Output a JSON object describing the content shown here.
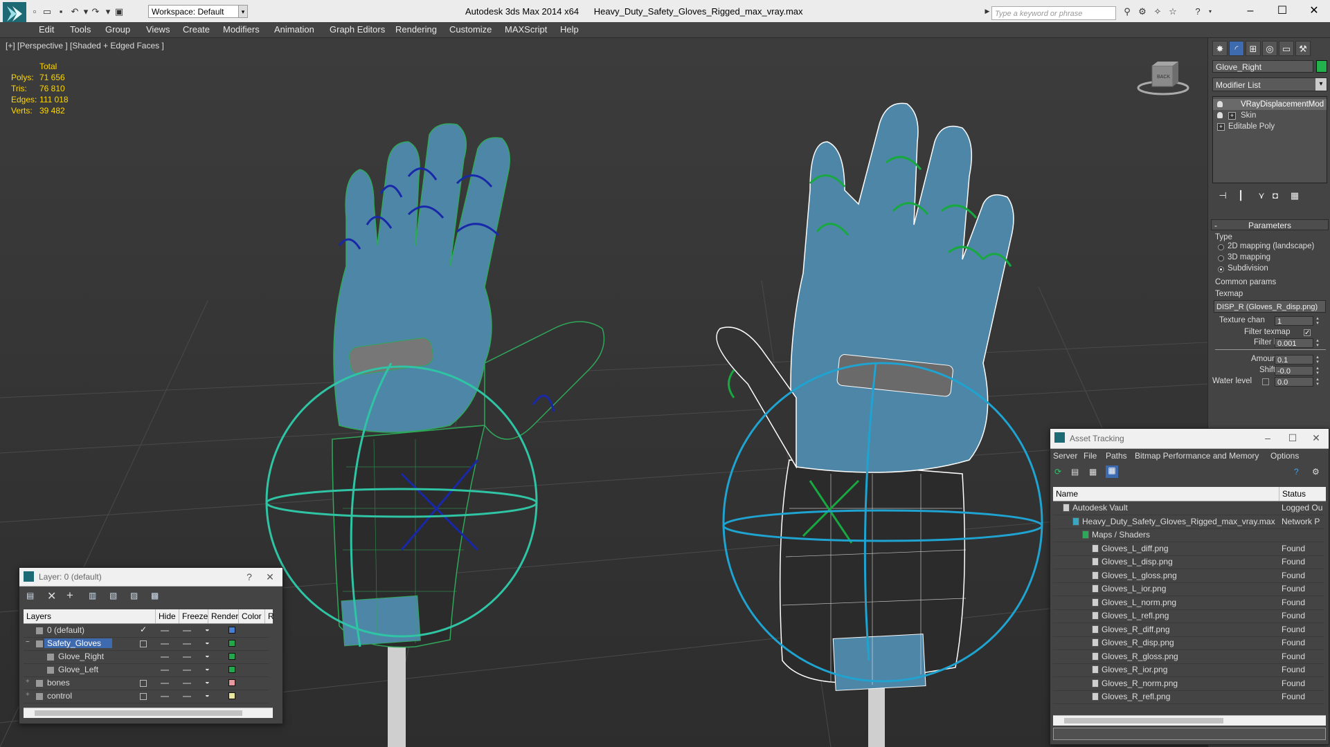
{
  "titlebar": {
    "workspace": "Workspace: Default",
    "app_name": "Autodesk 3ds Max  2014 x64",
    "file_name": "Heavy_Duty_Safety_Gloves_Rigged_max_vray.max",
    "search_placeholder": "Type a keyword or phrase"
  },
  "menu": [
    "Edit",
    "Tools",
    "Group",
    "Views",
    "Create",
    "Modifiers",
    "Animation",
    "Graph Editors",
    "Rendering",
    "Customize",
    "MAXScript",
    "Help"
  ],
  "viewport": {
    "label": "[+] [Perspective ] [Shaded + Edged Faces ]",
    "stats": {
      "header": "Total",
      "rows": [
        {
          "key": "Polys:",
          "value": "71 656"
        },
        {
          "key": "Tris:",
          "value": "76 810"
        },
        {
          "key": "Edges:",
          "value": "111 018"
        },
        {
          "key": "Verts:",
          "value": "39 482"
        }
      ]
    },
    "viewcube_label": "BACK"
  },
  "command_panel": {
    "object_name": "Glove_Right",
    "object_color": "#22b14c",
    "modifier_list": "Modifier List",
    "stack": [
      "VRayDisplacementMod",
      "Skin",
      "Editable Poly"
    ],
    "rollout_title": "Parameters",
    "type_label": "Type",
    "type_options": [
      "2D mapping (landscape)",
      "3D mapping",
      "Subdivision"
    ],
    "type_selected": 2,
    "common_params": "Common params",
    "texmap_label": "Texmap",
    "texmap_value": "DISP_R (Gloves_R_disp.png)",
    "texture_chan_label": "Texture chan",
    "texture_chan_value": "1",
    "filter_texmap_label": "Filter texmap",
    "filter_blur_label": "Filter blur",
    "filter_blur_value": "0.001",
    "amount_label": "Amount",
    "amount_value": "0.1",
    "shift_label": "Shift",
    "shift_value": "-0.0",
    "water_level_label": "Water level",
    "water_level_value": "0.0"
  },
  "layer_window": {
    "title": "Layer: 0 (default)",
    "help": "?",
    "close": "✕",
    "columns": [
      "Layers",
      "Hide",
      "Freeze",
      "Render",
      "Color",
      "R"
    ],
    "rows": [
      {
        "name": "0 (default)",
        "indent": 1,
        "color": "#4a7ecf",
        "selected": false
      },
      {
        "name": "Safety_Gloves",
        "indent": 1,
        "color": "#22a84a",
        "selected": true
      },
      {
        "name": "Glove_Right",
        "indent": 2,
        "color": "#22a84a",
        "selected": false
      },
      {
        "name": "Glove_Left",
        "indent": 2,
        "color": "#22a84a",
        "selected": false
      },
      {
        "name": "bones",
        "indent": 1,
        "color": "#e89aa0",
        "selected": false
      },
      {
        "name": "control",
        "indent": 1,
        "color": "#e8e8a0",
        "selected": false
      }
    ]
  },
  "asset_window": {
    "title": "Asset Tracking",
    "menu": [
      "Server",
      "File",
      "Paths",
      "Bitmap Performance and Memory",
      "Options"
    ],
    "columns": [
      "Name",
      "Status"
    ],
    "rows": [
      {
        "name": "Autodesk Vault",
        "status": "Logged Ou",
        "indent": 1
      },
      {
        "name": "Heavy_Duty_Safety_Gloves_Rigged_max_vray.max",
        "status": "Network P",
        "indent": 2
      },
      {
        "name": "Maps / Shaders",
        "status": "",
        "indent": 3
      },
      {
        "name": "Gloves_L_diff.png",
        "status": "Found",
        "indent": 4
      },
      {
        "name": "Gloves_L_disp.png",
        "status": "Found",
        "indent": 4
      },
      {
        "name": "Gloves_L_gloss.png",
        "status": "Found",
        "indent": 4
      },
      {
        "name": "Gloves_L_ior.png",
        "status": "Found",
        "indent": 4
      },
      {
        "name": "Gloves_L_norm.png",
        "status": "Found",
        "indent": 4
      },
      {
        "name": "Gloves_L_refl.png",
        "status": "Found",
        "indent": 4
      },
      {
        "name": "Gloves_R_diff.png",
        "status": "Found",
        "indent": 4
      },
      {
        "name": "Gloves_R_disp.png",
        "status": "Found",
        "indent": 4
      },
      {
        "name": "Gloves_R_gloss.png",
        "status": "Found",
        "indent": 4
      },
      {
        "name": "Gloves_R_ior.png",
        "status": "Found",
        "indent": 4
      },
      {
        "name": "Gloves_R_norm.png",
        "status": "Found",
        "indent": 4
      },
      {
        "name": "Gloves_R_refl.png",
        "status": "Found",
        "indent": 4
      }
    ]
  },
  "colors": {
    "glove_blue": "#4e86a8",
    "glove_dark": "#2b2b2b",
    "rig_teal": "#2ec4a4",
    "rig_cyan": "#1fa3d0",
    "bone_blue": "#1828a8",
    "bone_green": "#18a840"
  }
}
